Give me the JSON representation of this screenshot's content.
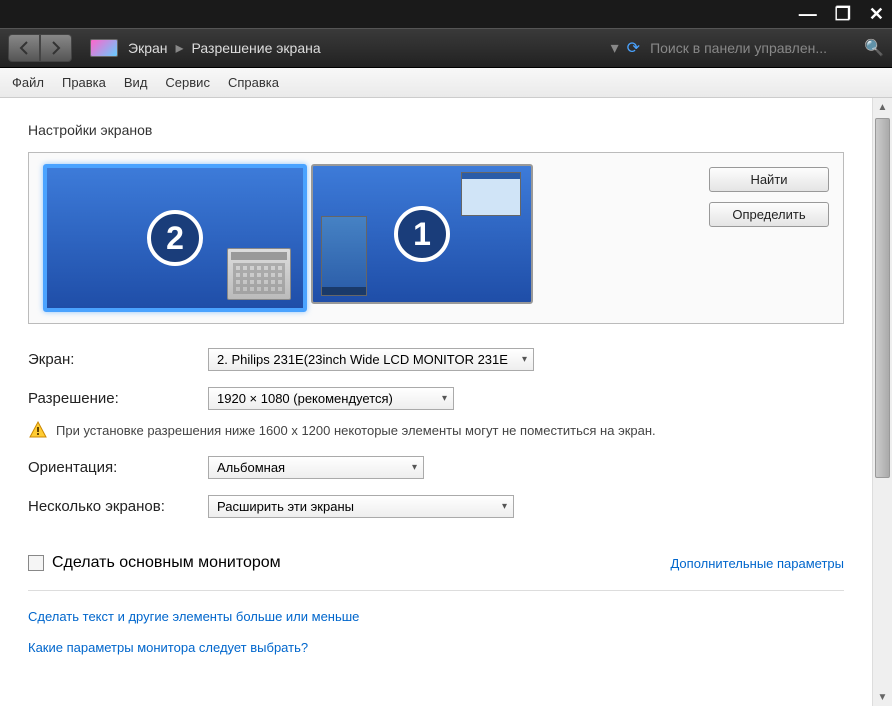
{
  "titlebar": {
    "minimize": "—",
    "maximize": "❐",
    "close": "✕"
  },
  "nav": {
    "crumb1": "Экран",
    "crumb2": "Разрешение экрана",
    "search_placeholder": "Поиск в панели управлен..."
  },
  "menu": {
    "file": "Файл",
    "edit": "Правка",
    "view": "Вид",
    "service": "Сервис",
    "help": "Справка"
  },
  "section_title": "Настройки экранов",
  "monitors": [
    {
      "num": "2",
      "selected": true
    },
    {
      "num": "1",
      "selected": false
    }
  ],
  "buttons": {
    "find": "Найти",
    "identify": "Определить"
  },
  "form": {
    "screen_label": "Экран:",
    "screen_value": "2. Philips 231E(23inch Wide LCD MONITOR 231E",
    "resolution_label": "Разрешение:",
    "resolution_value": "1920 × 1080 (рекомендуется)",
    "warning": "При установке разрешения ниже 1600 х 1200 некоторые элементы могут не поместиться на экран.",
    "orientation_label": "Ориентация:",
    "orientation_value": "Альбомная",
    "multi_label": "Несколько экранов:",
    "multi_value": "Расширить эти экраны"
  },
  "checkbox_label": "Сделать основным монитором",
  "adv_link": "Дополнительные параметры",
  "link1": "Сделать текст и другие элементы больше или меньше",
  "link2": "Какие параметры монитора следует выбрать?"
}
